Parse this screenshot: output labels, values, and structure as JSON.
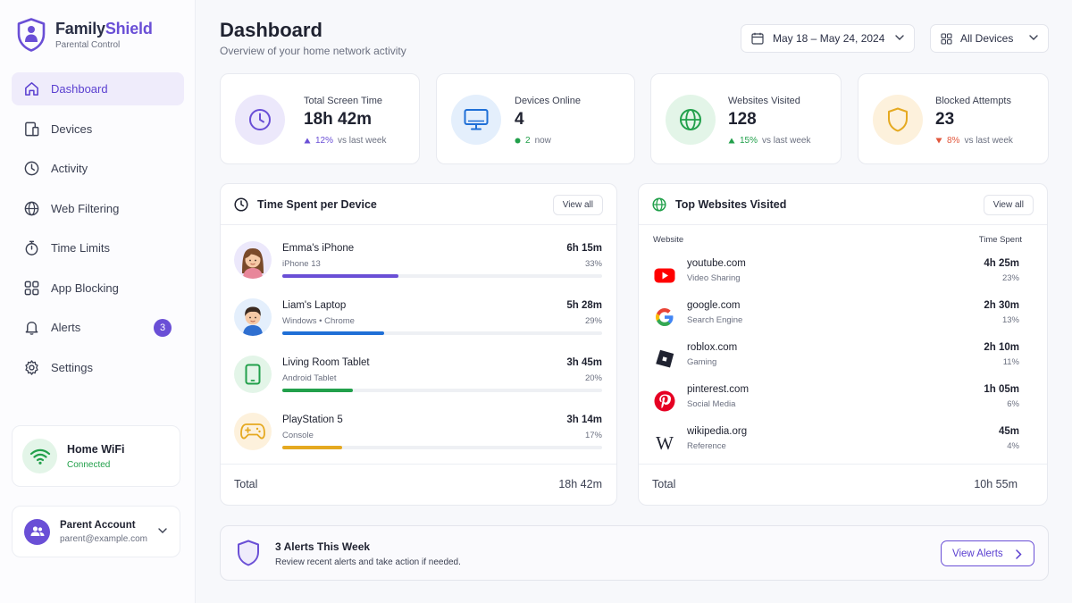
{
  "brand": {
    "name_part1": "Family",
    "name_part2": "Shield",
    "subtitle": "Parental Control",
    "accent_color": "#6a4fd6"
  },
  "sidebar": {
    "items": [
      {
        "label": "Dashboard",
        "icon": "home-icon",
        "active": true
      },
      {
        "label": "Devices",
        "icon": "devices-icon"
      },
      {
        "label": "Activity",
        "icon": "clock-icon"
      },
      {
        "label": "Web Filtering",
        "icon": "globe-icon"
      },
      {
        "label": "Time Limits",
        "icon": "stopwatch-icon"
      },
      {
        "label": "App Blocking",
        "icon": "grid-icon"
      },
      {
        "label": "Alerts",
        "icon": "bell-icon",
        "badge": "3"
      },
      {
        "label": "Settings",
        "icon": "gear-icon"
      }
    ],
    "network": {
      "name": "Home WiFi",
      "status": "Connected"
    },
    "account": {
      "name": "Parent Account",
      "email": "parent@example.com"
    }
  },
  "header": {
    "title": "Dashboard",
    "subtitle": "Overview of your home network activity",
    "date_range": "May 18 – May 24, 2024",
    "device_filter": "All Devices"
  },
  "stats": [
    {
      "label": "Total Screen Time",
      "value": "18h 42m",
      "delta": "12%",
      "delta_text": "vs last week",
      "direction": "up",
      "delta_color": "#6a4fd6"
    },
    {
      "label": "Devices Online",
      "value": "4",
      "delta": "2",
      "delta_text": "now",
      "direction": "dot",
      "delta_color": "#22a04b"
    },
    {
      "label": "Websites Visited",
      "value": "128",
      "delta": "15%",
      "delta_text": "vs last week",
      "direction": "up",
      "delta_color": "#22a04b"
    },
    {
      "label": "Blocked Attempts",
      "value": "23",
      "delta": "8%",
      "delta_text": "vs last week",
      "direction": "down",
      "delta_color": "#e2583e"
    }
  ],
  "time_panel": {
    "title": "Time Spent per Device",
    "view_all": "View all",
    "devices": [
      {
        "name": "Emma's iPhone",
        "sub": "iPhone 13",
        "time": "6h 15m",
        "pct": "33%",
        "fraction": 0.33,
        "color": "#6a4fd6",
        "icon": "girl-avatar-icon"
      },
      {
        "name": "Liam's Laptop",
        "sub": "Windows • Chrome",
        "time": "5h 28m",
        "pct": "29%",
        "fraction": 0.29,
        "color": "#1f6fd6",
        "icon": "boy-avatar-icon"
      },
      {
        "name": "Living Room Tablet",
        "sub": "Android Tablet",
        "time": "3h 45m",
        "pct": "20%",
        "fraction": 0.2,
        "color": "#22a04b",
        "icon": "tablet-icon"
      },
      {
        "name": "PlayStation 5",
        "sub": "Console",
        "time": "3h 14m",
        "pct": "17%",
        "fraction": 0.17,
        "color": "#e5a920",
        "icon": "gamepad-icon"
      }
    ],
    "total_label": "Total",
    "total_value": "18h 42m"
  },
  "sites_panel": {
    "title": "Top Websites Visited",
    "view_all": "View all",
    "col_website": "Website",
    "col_time": "Time Spent",
    "sites": [
      {
        "name": "youtube.com",
        "category": "Video Sharing",
        "time": "4h 25m",
        "pct": "23%",
        "icon": "youtube-icon"
      },
      {
        "name": "google.com",
        "category": "Search Engine",
        "time": "2h 30m",
        "pct": "13%",
        "icon": "google-icon"
      },
      {
        "name": "roblox.com",
        "category": "Gaming",
        "time": "2h 10m",
        "pct": "11%",
        "icon": "roblox-icon"
      },
      {
        "name": "pinterest.com",
        "category": "Social Media",
        "time": "1h 05m",
        "pct": "6%",
        "icon": "pinterest-icon"
      },
      {
        "name": "wikipedia.org",
        "category": "Reference",
        "time": "45m",
        "pct": "4%",
        "icon": "wikipedia-icon",
        "glyph": "W"
      }
    ],
    "total_label": "Total",
    "total_value": "10h 55m"
  },
  "alerts_bar": {
    "title": "3 Alerts This Week",
    "subtitle": "Review recent alerts and take action if needed.",
    "button": "View Alerts"
  }
}
